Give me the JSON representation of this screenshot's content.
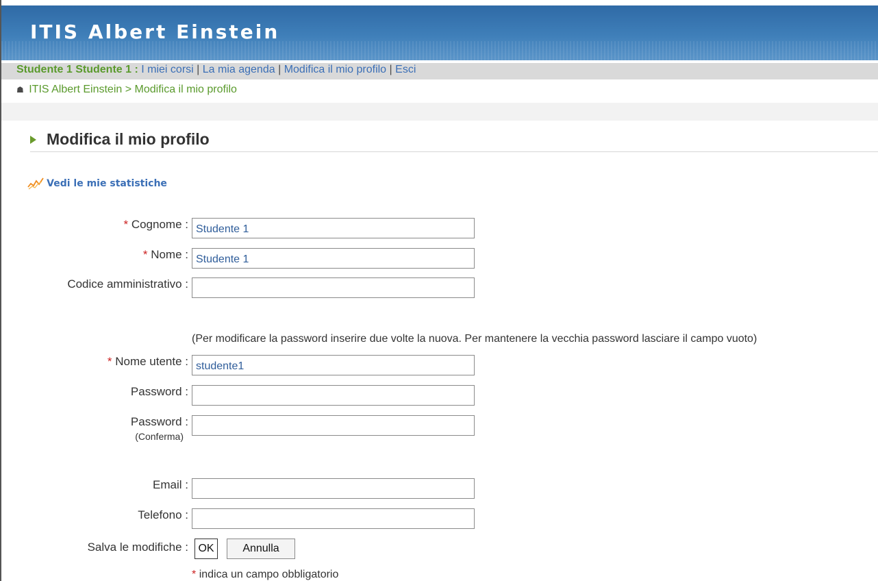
{
  "header": {
    "site_title": "ITIS Albert Einstein"
  },
  "topbar": {
    "user": "Studente 1 Studente 1 :",
    "links": [
      "I miei corsi",
      "La mia agenda",
      "Modifica il mio profilo",
      "Esci"
    ],
    "separator": "|"
  },
  "breadcrumb": {
    "home": "ITIS Albert Einstein",
    "arrow": ">",
    "current": "Modifica il mio profilo"
  },
  "page": {
    "title": "Modifica il mio profilo",
    "stats_link": "Vedi le mie statistiche"
  },
  "form": {
    "required_mark": "*",
    "cognome": {
      "label": "Cognome :",
      "value": "Studente 1"
    },
    "nome": {
      "label": "Nome :",
      "value": "Studente 1"
    },
    "codice": {
      "label": "Codice amministrativo :",
      "value": ""
    },
    "password_hint": "(Per modificare la password inserire due volte la nuova. Per mantenere la vecchia password lasciare il campo vuoto)",
    "username": {
      "label": "Nome utente :",
      "value": "studente1"
    },
    "password": {
      "label": "Password :",
      "value": ""
    },
    "password_confirm": {
      "label": "Password :",
      "sublabel": "(Conferma)",
      "value": ""
    },
    "email": {
      "label": "Email :",
      "value": ""
    },
    "telefono": {
      "label": "Telefono :",
      "value": ""
    },
    "save": {
      "label": "Salva le modifiche :",
      "ok": "OK",
      "cancel": "Annulla"
    },
    "required_note": "indica un campo obbligatorio"
  },
  "colors": {
    "banner": "#3f7fb9",
    "link_blue": "#3b6fb6",
    "link_green": "#5a9a2c",
    "required_red": "#cc2222"
  }
}
